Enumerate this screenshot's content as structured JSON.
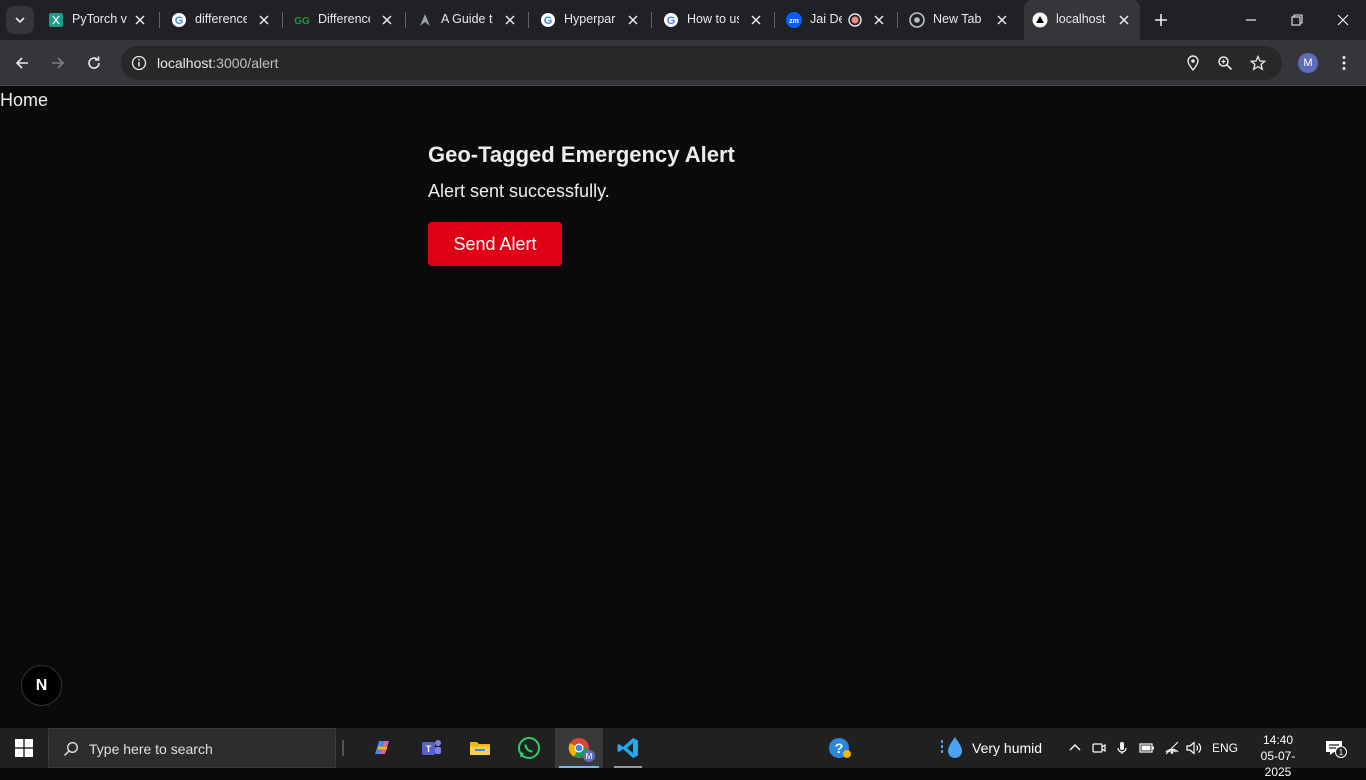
{
  "browser": {
    "tabs": [
      {
        "title": "PyTorch v",
        "icon": "pytorch-icon"
      },
      {
        "title": "difference",
        "icon": "google-icon"
      },
      {
        "title": "Difference",
        "icon": "geeksforgeeks-icon"
      },
      {
        "title": "A Guide to",
        "icon": "guide-icon"
      },
      {
        "title": "Hyperpar",
        "icon": "google-icon"
      },
      {
        "title": "How to us",
        "icon": "google-icon"
      },
      {
        "title": "Jai De",
        "icon": "zoom-icon"
      },
      {
        "title": "New Tab",
        "icon": "chrome-icon"
      },
      {
        "title": "localhost",
        "icon": "nextjs-icon",
        "active": true
      }
    ],
    "url_host": "localhost",
    "url_path": ":3000/alert",
    "profile_initial": "M"
  },
  "page": {
    "home_link": "Home",
    "heading": "Geo-Tagged Emergency Alert",
    "status": "Alert sent successfully.",
    "send_button": "Send Alert",
    "next_badge": "N",
    "button_color": "#e00015"
  },
  "taskbar": {
    "search_placeholder": "Type here to search",
    "weather": "Very humid",
    "language": "ENG",
    "time": "14:40",
    "date": "05-07-2025",
    "notification_count": "1"
  }
}
